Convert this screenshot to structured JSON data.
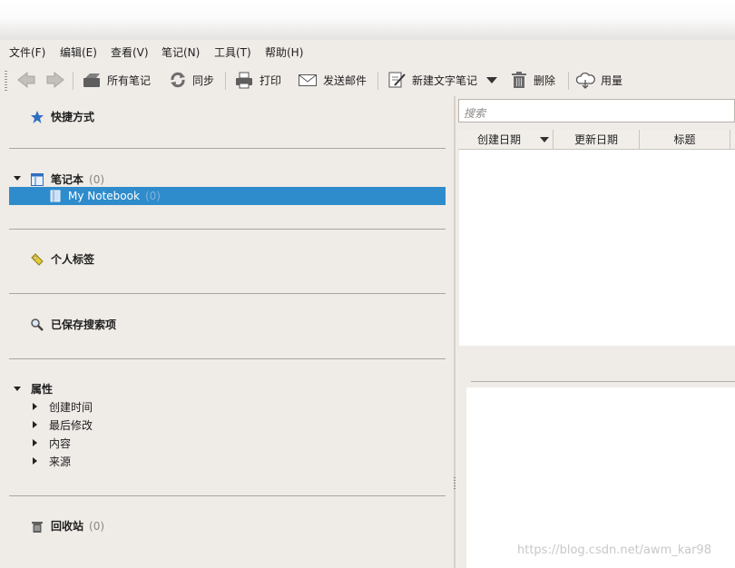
{
  "menubar": {
    "items": [
      "文件(F)",
      "编辑(E)",
      "查看(V)",
      "笔记(N)",
      "工具(T)",
      "帮助(H)"
    ]
  },
  "toolbar": {
    "all_notes": "所有笔记",
    "sync": "同步",
    "print": "打印",
    "send_email": "发送邮件",
    "new_text_note": "新建文字笔记",
    "delete": "删除",
    "usage": "用量"
  },
  "sidebar": {
    "shortcuts": "快捷方式",
    "notebooks": {
      "label": "笔记本",
      "count": "(0)"
    },
    "notebook_item": {
      "label": "My Notebook",
      "count": "(0)"
    },
    "tags": "个人标签",
    "saved_searches": "已保存搜索项",
    "attributes": {
      "label": "属性",
      "items": [
        "创建时间",
        "最后修改",
        "内容",
        "来源"
      ]
    },
    "trash": {
      "label": "回收站",
      "count": "(0)"
    }
  },
  "search": {
    "placeholder": "搜索"
  },
  "note_list": {
    "columns": [
      "创建日期",
      "更新日期",
      "标题"
    ]
  },
  "watermark": "https://blog.csdn.net/awm_kar98",
  "colors": {
    "selection": "#2f8ccc",
    "background": "#efebe7"
  }
}
